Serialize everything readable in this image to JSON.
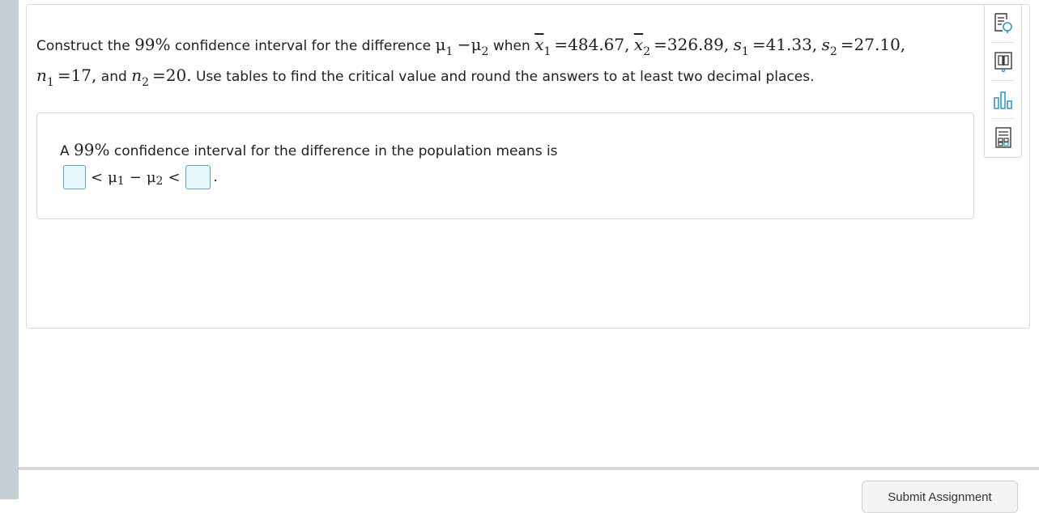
{
  "question": {
    "line1": {
      "intro": "Construct the",
      "conf": "99%",
      "mid": "confidence interval for the difference",
      "mu": "μ",
      "sub1": "1",
      "minus": "−",
      "sub2": "2",
      "when": "when",
      "x": "x",
      "eq_x1": "=484.67,",
      "eq_x2": "=326.89,",
      "s": "s",
      "eq_s1": "=41.33,",
      "eq_s2": "=27.10,"
    },
    "line2": {
      "n": "n",
      "sub1": "1",
      "sub2": "2",
      "eq_n1": "=17,",
      "and": "and",
      "eq_n2": "=20.",
      "rest": "Use tables to find the critical value and round the answers to at least two decimal places."
    }
  },
  "answer": {
    "prefix": "A",
    "conf": "99%",
    "text": "confidence interval for the difference in the population means is",
    "lt": "<",
    "mu": "μ",
    "sub1": "1",
    "sub2": "2",
    "minus": "−",
    "period": ".",
    "lower_value": "",
    "upper_value": ""
  },
  "toolbar": {
    "tools": [
      "question-help-icon",
      "textbook-icon",
      "statdata-icon",
      "calculator-icon"
    ]
  },
  "footer": {
    "submit_label": "Submit Assignment"
  },
  "colors": {
    "input_border": "#5aa4c8",
    "input_fill": "#e9f6fb",
    "icon_color": "#3a3a3a",
    "icon_accent": "#2b93c9",
    "left_strip": "#c3ced5"
  }
}
